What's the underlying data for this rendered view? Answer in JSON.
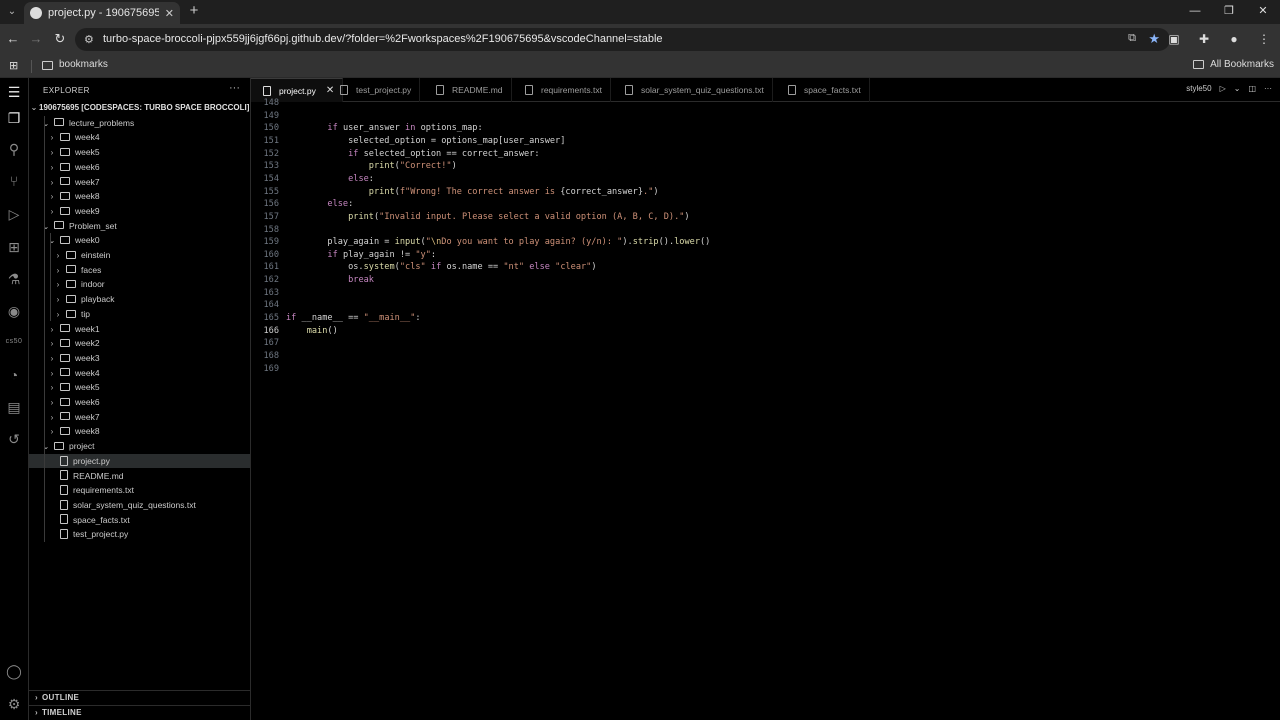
{
  "browser": {
    "tab_title": "project.py - 190675695 [Codesp",
    "url": "turbo-space-broccoli-pjpx559jj6jgf66pj.github.dev/?folder=%2Fworkspaces%2F190675695&vscodeChannel=stable",
    "bookmark_folder": "bookmarks",
    "all_bookmarks": "All Bookmarks"
  },
  "sidebar": {
    "title": "EXPLORER",
    "root": "190675695 [CODESPACES: TURBO SPACE BROCCOLI]",
    "tree": [
      {
        "label": "lecture_problems",
        "depth": 0,
        "type": "folder",
        "open": true
      },
      {
        "label": "week4",
        "depth": 1,
        "type": "folder",
        "open": false
      },
      {
        "label": "week5",
        "depth": 1,
        "type": "folder",
        "open": false
      },
      {
        "label": "week6",
        "depth": 1,
        "type": "folder",
        "open": false
      },
      {
        "label": "week7",
        "depth": 1,
        "type": "folder",
        "open": false
      },
      {
        "label": "week8",
        "depth": 1,
        "type": "folder",
        "open": false
      },
      {
        "label": "week9",
        "depth": 1,
        "type": "folder",
        "open": false
      },
      {
        "label": "Problem_set",
        "depth": 0,
        "type": "folder",
        "open": true
      },
      {
        "label": "week0",
        "depth": 1,
        "type": "folder",
        "open": true
      },
      {
        "label": "einstein",
        "depth": 2,
        "type": "folder",
        "open": false
      },
      {
        "label": "faces",
        "depth": 2,
        "type": "folder",
        "open": false
      },
      {
        "label": "indoor",
        "depth": 2,
        "type": "folder",
        "open": false
      },
      {
        "label": "playback",
        "depth": 2,
        "type": "folder",
        "open": false
      },
      {
        "label": "tip",
        "depth": 2,
        "type": "folder",
        "open": false
      },
      {
        "label": "week1",
        "depth": 1,
        "type": "folder",
        "open": false
      },
      {
        "label": "week2",
        "depth": 1,
        "type": "folder",
        "open": false
      },
      {
        "label": "week3",
        "depth": 1,
        "type": "folder",
        "open": false
      },
      {
        "label": "week4",
        "depth": 1,
        "type": "folder",
        "open": false
      },
      {
        "label": "week5",
        "depth": 1,
        "type": "folder",
        "open": false
      },
      {
        "label": "week6",
        "depth": 1,
        "type": "folder",
        "open": false
      },
      {
        "label": "week7",
        "depth": 1,
        "type": "folder",
        "open": false
      },
      {
        "label": "week8",
        "depth": 1,
        "type": "folder",
        "open": false
      },
      {
        "label": "project",
        "depth": 0,
        "type": "folder",
        "open": true
      },
      {
        "label": "project.py",
        "depth": 1,
        "type": "file",
        "selected": true
      },
      {
        "label": "README.md",
        "depth": 1,
        "type": "file"
      },
      {
        "label": "requirements.txt",
        "depth": 1,
        "type": "file"
      },
      {
        "label": "solar_system_quiz_questions.txt",
        "depth": 1,
        "type": "file"
      },
      {
        "label": "space_facts.txt",
        "depth": 1,
        "type": "file"
      },
      {
        "label": "test_project.py",
        "depth": 1,
        "type": "file"
      }
    ],
    "outline": "OUTLINE",
    "timeline": "TIMELINE"
  },
  "activity_bar": {
    "icons": [
      "menu-icon",
      "explorer-icon",
      "search-icon",
      "source-control-icon",
      "run-debug-icon",
      "extensions-icon",
      "testing-icon",
      "github-icon",
      "cs50-icon",
      "ducky-icon",
      "docker-icon",
      "remote-icon"
    ],
    "cs50_label": "cs50",
    "bottom_icons": [
      "accounts-icon",
      "settings-icon"
    ]
  },
  "editor": {
    "tabs": [
      {
        "label": "project.py",
        "active": true
      },
      {
        "label": "test_project.py"
      },
      {
        "label": "README.md"
      },
      {
        "label": "requirements.txt"
      },
      {
        "label": "solar_system_quiz_questions.txt"
      },
      {
        "label": "space_facts.txt"
      }
    ],
    "right_label": "style50",
    "current_line": 166,
    "lines": [
      {
        "n": 148,
        "tokens": []
      },
      {
        "n": 149,
        "tokens": []
      },
      {
        "n": 150,
        "tokens": [
          [
            "o",
            "        "
          ],
          [
            "k",
            "if"
          ],
          [
            "o",
            " user_answer "
          ],
          [
            "k",
            "in"
          ],
          [
            "o",
            " options_map:"
          ]
        ]
      },
      {
        "n": 151,
        "tokens": [
          [
            "o",
            "            selected_option = options_map[user_answer]"
          ]
        ]
      },
      {
        "n": 152,
        "tokens": [
          [
            "o",
            "            "
          ],
          [
            "k",
            "if"
          ],
          [
            "o",
            " selected_option == correct_answer:"
          ]
        ]
      },
      {
        "n": 153,
        "tokens": [
          [
            "o",
            "                "
          ],
          [
            "f",
            "print"
          ],
          [
            "o",
            "("
          ],
          [
            "s",
            "\"Correct!\""
          ],
          [
            "o",
            ")"
          ]
        ]
      },
      {
        "n": 154,
        "tokens": [
          [
            "o",
            "            "
          ],
          [
            "k",
            "else"
          ],
          [
            "o",
            ":"
          ]
        ]
      },
      {
        "n": 155,
        "tokens": [
          [
            "o",
            "                "
          ],
          [
            "f",
            "print"
          ],
          [
            "o",
            "("
          ],
          [
            "s",
            "f\"Wrong! The correct answer is "
          ],
          [
            "o",
            "{correct_answer}"
          ],
          [
            "s",
            ".\""
          ],
          [
            "o",
            ")"
          ]
        ]
      },
      {
        "n": 156,
        "tokens": [
          [
            "o",
            "        "
          ],
          [
            "k",
            "else"
          ],
          [
            "o",
            ":"
          ]
        ]
      },
      {
        "n": 157,
        "tokens": [
          [
            "o",
            "            "
          ],
          [
            "f",
            "print"
          ],
          [
            "o",
            "("
          ],
          [
            "s",
            "\"Invalid input. Please select a valid option (A, B, C, D).\""
          ],
          [
            "o",
            ")"
          ]
        ]
      },
      {
        "n": 158,
        "tokens": []
      },
      {
        "n": 159,
        "tokens": [
          [
            "o",
            "        play_again = "
          ],
          [
            "f",
            "input"
          ],
          [
            "o",
            "("
          ],
          [
            "s",
            "\""
          ],
          [
            "e",
            "\\n"
          ],
          [
            "s",
            "Do you want to play again? (y/n): \""
          ],
          [
            "o",
            ")."
          ],
          [
            "f",
            "strip"
          ],
          [
            "o",
            "()."
          ],
          [
            "f",
            "lower"
          ],
          [
            "o",
            "()"
          ]
        ]
      },
      {
        "n": 160,
        "tokens": [
          [
            "o",
            "        "
          ],
          [
            "k",
            "if"
          ],
          [
            "o",
            " play_again != "
          ],
          [
            "s",
            "\"y\""
          ],
          [
            "o",
            ":"
          ]
        ]
      },
      {
        "n": 161,
        "tokens": [
          [
            "o",
            "            os."
          ],
          [
            "f",
            "system"
          ],
          [
            "o",
            "("
          ],
          [
            "s",
            "\"cls\""
          ],
          [
            "o",
            " "
          ],
          [
            "k",
            "if"
          ],
          [
            "o",
            " os.name == "
          ],
          [
            "s",
            "\"nt\""
          ],
          [
            "o",
            " "
          ],
          [
            "k",
            "else"
          ],
          [
            "o",
            " "
          ],
          [
            "s",
            "\"clear\""
          ],
          [
            "o",
            ")"
          ]
        ]
      },
      {
        "n": 162,
        "tokens": [
          [
            "o",
            "            "
          ],
          [
            "k",
            "break"
          ]
        ]
      },
      {
        "n": 163,
        "tokens": []
      },
      {
        "n": 164,
        "tokens": []
      },
      {
        "n": 165,
        "tokens": [
          [
            "k",
            "if"
          ],
          [
            "o",
            " __name__ == "
          ],
          [
            "s",
            "\"__main__\""
          ],
          [
            "o",
            ":"
          ]
        ]
      },
      {
        "n": 166,
        "tokens": [
          [
            "o",
            "    "
          ],
          [
            "f",
            "main"
          ],
          [
            "o",
            "()"
          ]
        ]
      },
      {
        "n": 167,
        "tokens": []
      },
      {
        "n": 168,
        "tokens": []
      },
      {
        "n": 169,
        "tokens": []
      }
    ]
  }
}
